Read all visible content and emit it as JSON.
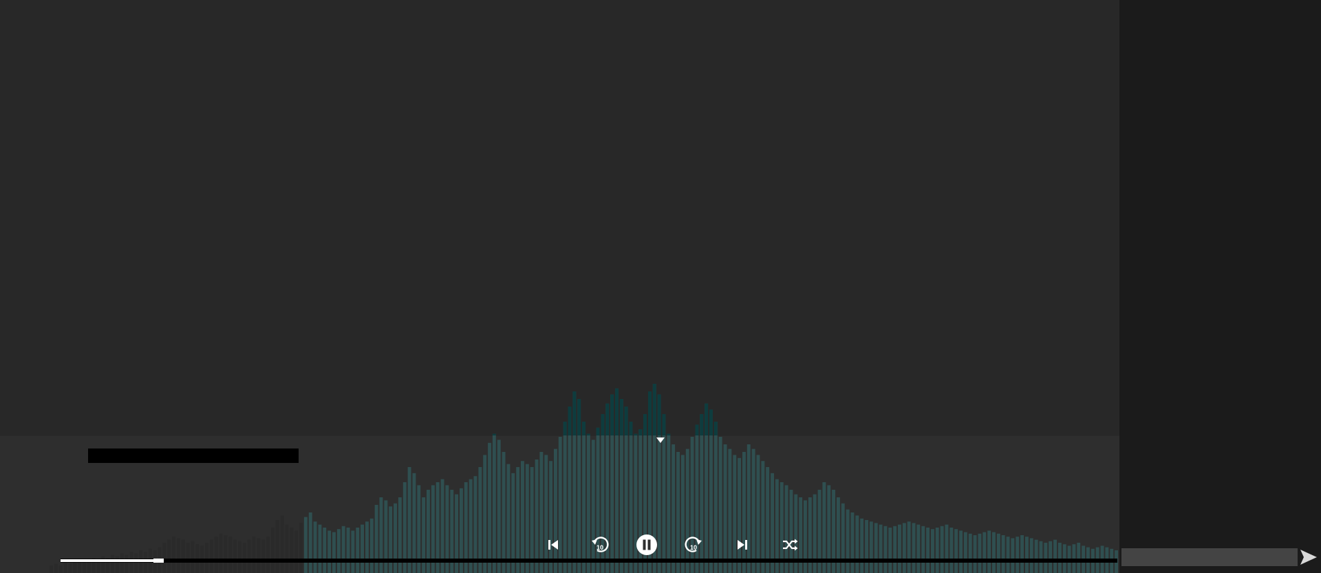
{
  "colors": {
    "background": "#282828",
    "player_bar": "#2e2e2e",
    "sidebar": "#1b1b1b",
    "bar_teal": "#2f5556",
    "bar_teal_top": "#0e3c3e",
    "bar_dark": "#2a2a2a",
    "icon": "#ffffff"
  },
  "now_playing": {
    "title": ""
  },
  "controls": {
    "previous_icon": "skip-previous-icon",
    "rewind_icon": "replay-10-icon",
    "rewind_label": "10",
    "play_pause_icon": "pause-circle-icon",
    "forward_icon": "forward-10-icon",
    "forward_label": "10",
    "next_icon": "skip-next-icon",
    "shuffle_icon": "shuffle-icon"
  },
  "progress": {
    "fraction": 0.093
  },
  "collapse": {
    "icon": "caret-down-icon"
  },
  "chat": {
    "input_value": "",
    "input_placeholder": "",
    "send_icon": "send-icon"
  },
  "visualizer": {
    "bar_levels": [
      0.05,
      0.06,
      0.05,
      0.07,
      0.06,
      0.08,
      0.07,
      0.09,
      0.08,
      0.1,
      0.09,
      0.11,
      0.1,
      0.12,
      0.11,
      0.13,
      0.12,
      0.14,
      0.13,
      0.15,
      0.14,
      0.16,
      0.15,
      0.17,
      0.2,
      0.22,
      0.24,
      0.23,
      0.22,
      0.2,
      0.21,
      0.19,
      0.18,
      0.2,
      0.22,
      0.24,
      0.26,
      0.25,
      0.24,
      0.22,
      0.21,
      0.2,
      0.22,
      0.24,
      0.23,
      0.22,
      0.24,
      0.3,
      0.35,
      0.38,
      0.32,
      0.3,
      0.28,
      0.33,
      0.37,
      0.4,
      0.34,
      0.32,
      0.3,
      0.28,
      0.27,
      0.29,
      0.31,
      0.3,
      0.28,
      0.3,
      0.32,
      0.34,
      0.36,
      0.45,
      0.5,
      0.48,
      0.44,
      0.46,
      0.5,
      0.6,
      0.7,
      0.66,
      0.58,
      0.5,
      0.55,
      0.58,
      0.6,
      0.62,
      0.58,
      0.55,
      0.52,
      0.56,
      0.6,
      0.62,
      0.64,
      0.7,
      0.78,
      0.86,
      0.92,
      0.88,
      0.8,
      0.72,
      0.66,
      0.7,
      0.74,
      0.72,
      0.7,
      0.75,
      0.8,
      0.78,
      0.74,
      0.82,
      0.9,
      1.0,
      1.1,
      1.2,
      1.15,
      1.0,
      0.92,
      0.88,
      0.96,
      1.05,
      1.12,
      1.18,
      1.22,
      1.15,
      1.1,
      1.0,
      0.92,
      0.95,
      1.05,
      1.2,
      1.25,
      1.18,
      1.05,
      0.92,
      0.85,
      0.8,
      0.78,
      0.82,
      0.9,
      0.98,
      1.05,
      1.12,
      1.08,
      1.0,
      0.9,
      0.85,
      0.82,
      0.78,
      0.76,
      0.8,
      0.85,
      0.82,
      0.78,
      0.74,
      0.7,
      0.66,
      0.62,
      0.6,
      0.58,
      0.55,
      0.52,
      0.5,
      0.48,
      0.5,
      0.52,
      0.55,
      0.6,
      0.58,
      0.55,
      0.5,
      0.46,
      0.42,
      0.4,
      0.38,
      0.36,
      0.35,
      0.34,
      0.33,
      0.32,
      0.31,
      0.3,
      0.31,
      0.32,
      0.33,
      0.34,
      0.33,
      0.32,
      0.31,
      0.3,
      0.29,
      0.3,
      0.31,
      0.32,
      0.3,
      0.29,
      0.28,
      0.27,
      0.26,
      0.25,
      0.26,
      0.27,
      0.28,
      0.27,
      0.26,
      0.25,
      0.24,
      0.23,
      0.24,
      0.25,
      0.24,
      0.23,
      0.22,
      0.21,
      0.2,
      0.21,
      0.22,
      0.2,
      0.19,
      0.18,
      0.19,
      0.2,
      0.18,
      0.17,
      0.16,
      0.17,
      0.18,
      0.17,
      0.16,
      0.15
    ]
  }
}
